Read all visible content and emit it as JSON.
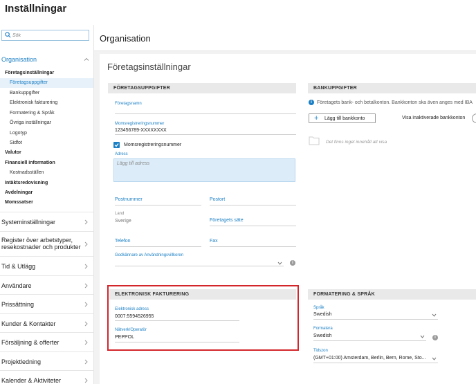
{
  "app": {
    "title": "Inställningar"
  },
  "search": {
    "placeholder": "Sök"
  },
  "sidebar": {
    "organisation": "Organisation",
    "sub": {
      "foretagsinstallningar": "Företagsinställningar",
      "foretagsuppgifter": "Företagsuppgifter",
      "bankuppgifter": "Bankuppgifter",
      "elektronisk_fakturering": "Elektronisk fakturering",
      "formatering": "Formatering & Språk",
      "ovriga": "Övriga inställningar",
      "logotyp": "Logotyp",
      "sidfot": "Sidfot",
      "valutor": "Valutor",
      "finansiell": "Finansiell information",
      "kostnadsstallen": "Kostnadsställen",
      "intakt": "Intäktsredovisning",
      "avdelningar": "Avdelningar",
      "momssatser": "Momssatser"
    },
    "main": {
      "system": "Systeminställningar",
      "register_1": "Register över arbetstyper,",
      "register_2": "resekostnader och produkter",
      "tid": "Tid & Utlägg",
      "anvandare": "Användare",
      "prissattning": "Prissättning",
      "kunder": "Kunder & Kontakter",
      "forsaljning": "Försäljning & offerter",
      "projektledning": "Projektledning",
      "kalender": "Kalender & Aktiviteter"
    }
  },
  "page": {
    "title": "Organisation",
    "content_title": "Företagsinställningar"
  },
  "company": {
    "header": "FÖRETAGSUPPGIFTER",
    "name_label": "Företagsnamn",
    "name_value": "",
    "vat_label": "Momsregistreringsnummer",
    "vat_value": "123456789-XXXXXXXX",
    "vat_checkbox_label": "Momsregistreringsnummer",
    "address_label": "Adress",
    "address_placeholder": "Lägg till adress",
    "postnummer": "Postnummer",
    "postort": "Postort",
    "land_label": "Land",
    "land_value": "Sverige",
    "sate": "Företagets säte",
    "telefon": "Telefon",
    "fax": "Fax",
    "approver_label": "Godkännare av Användningsvillkoren",
    "approver_value": ""
  },
  "bank": {
    "header": "BANKUPPGIFTER",
    "info": "Företagets bank- och betalkonton. Bankkonton ska även anges med IBA",
    "add_button": "Lägg till bankkonto",
    "show_inactive": "Visa inaktiverade bankkonton",
    "empty": "Det finns inget innehåll att visa"
  },
  "einvoice": {
    "header": "ELEKTRONISK FAKTURERING",
    "address_label": "Elektronisk adress",
    "address_value": "0007:5594526955",
    "operator_label": "Nätverk/Operatör",
    "operator_value": "PEPPOL"
  },
  "format": {
    "header": "FORMATERING & SPRÅK",
    "language_label": "Språk",
    "language_value": "Swedish",
    "formatting_label": "Formatera",
    "formatting_value": "Swedish",
    "timezone_label": "Tidszon",
    "timezone_value": "(GMT+01:00) Amsterdam, Berlin, Bern, Rome, Sto..."
  },
  "colors": {
    "accent": "#1a7fc4",
    "highlight_border": "#d3262b"
  }
}
